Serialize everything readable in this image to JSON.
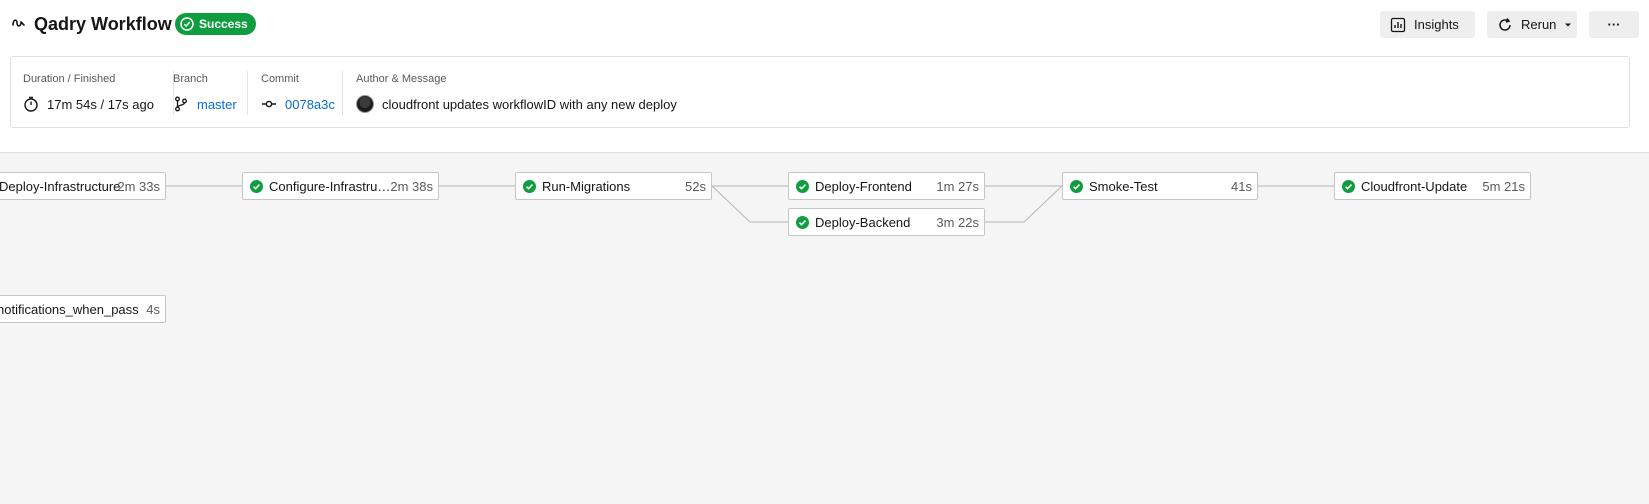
{
  "header": {
    "workflow_title": "Qadry Workflow",
    "status_badge": "Success",
    "insights_label": "Insights",
    "rerun_label": "Rerun",
    "more_label": "···"
  },
  "summary": {
    "duration": {
      "label": "Duration / Finished",
      "value": "17m 54s / 17s ago"
    },
    "branch": {
      "label": "Branch",
      "value": "master"
    },
    "commit": {
      "label": "Commit",
      "value": "0078a3c"
    },
    "author": {
      "label": "Author & Message",
      "message": "cloudfront updates workflowID with any new deploy"
    }
  },
  "jobs": [
    {
      "name": "Deploy-Infrastructure",
      "duration": "2m 33s",
      "status": "success"
    },
    {
      "name": "Configure-Infrastructure",
      "duration": "2m 38s",
      "status": "success"
    },
    {
      "name": "Run-Migrations",
      "duration": "52s",
      "status": "success"
    },
    {
      "name": "Deploy-Frontend",
      "duration": "1m 27s",
      "status": "success"
    },
    {
      "name": "Deploy-Backend",
      "duration": "3m 22s",
      "status": "success"
    },
    {
      "name": "Smoke-Test",
      "duration": "41s",
      "status": "success"
    },
    {
      "name": "Cloudfront-Update",
      "duration": "5m 21s",
      "status": "success"
    },
    {
      "name": "notifications_when_pass",
      "duration": "4s",
      "status": "success"
    }
  ],
  "colors": {
    "success": "#0f9d3f",
    "link": "#0a6ad6",
    "canvas": "#f5f5f5"
  },
  "icons": [
    "workflow-icon",
    "check-circle-icon",
    "insights-icon",
    "rerun-icon",
    "chevron-down-icon",
    "more-icon",
    "timer-icon",
    "branch-icon",
    "commit-icon",
    "avatar"
  ]
}
